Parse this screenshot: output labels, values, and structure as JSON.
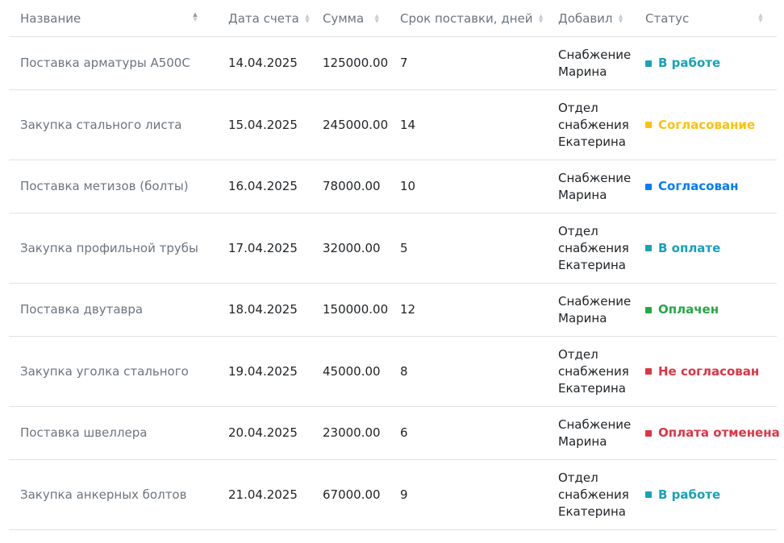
{
  "table": {
    "headers": {
      "name": "Название",
      "date": "Дата счета",
      "sum": "Сумма",
      "term": "Срок поставки, дней",
      "added_by": "Добавил",
      "status": "Статус"
    },
    "rows": [
      {
        "name": "Поставка арматуры А500С",
        "date": "14.04.2025",
        "sum": "125000.00",
        "term": "7",
        "added_by_line1": "Снабжение",
        "added_by_line2": "Марина",
        "added_by_line3": "",
        "status": "В работе",
        "status_color": "#17a2b8"
      },
      {
        "name": "Закупка стального листа",
        "date": "15.04.2025",
        "sum": "245000.00",
        "term": "14",
        "added_by_line1": "Отдел",
        "added_by_line2": "снабжения",
        "added_by_line3": "Екатерина",
        "status": "Согласование",
        "status_color": "#ffc107"
      },
      {
        "name": "Поставка метизов (болты)",
        "date": "16.04.2025",
        "sum": "78000.00",
        "term": "10",
        "added_by_line1": "Снабжение",
        "added_by_line2": "Марина",
        "added_by_line3": "",
        "status": "Согласован",
        "status_color": "#007bff"
      },
      {
        "name": "Закупка профильной трубы",
        "date": "17.04.2025",
        "sum": "32000.00",
        "term": "5",
        "added_by_line1": "Отдел",
        "added_by_line2": "снабжения",
        "added_by_line3": "Екатерина",
        "status": "В оплате",
        "status_color": "#17a2b8"
      },
      {
        "name": "Поставка двутавра",
        "date": "18.04.2025",
        "sum": "150000.00",
        "term": "12",
        "added_by_line1": "Снабжение",
        "added_by_line2": "Марина",
        "added_by_line3": "",
        "status": "Оплачен",
        "status_color": "#28a745"
      },
      {
        "name": "Закупка уголка стального",
        "date": "19.04.2025",
        "sum": "45000.00",
        "term": "8",
        "added_by_line1": "Отдел",
        "added_by_line2": "снабжения",
        "added_by_line3": "Екатерина",
        "status": "Не согласован",
        "status_color": "#dc3545"
      },
      {
        "name": "Поставка швеллера",
        "date": "20.04.2025",
        "sum": "23000.00",
        "term": "6",
        "added_by_line1": "Снабжение",
        "added_by_line2": "Марина",
        "added_by_line3": "",
        "status": "Оплата отменена",
        "status_color": "#dc3545"
      },
      {
        "name": "Закупка анкерных болтов",
        "date": "21.04.2025",
        "sum": "67000.00",
        "term": "9",
        "added_by_line1": "Отдел",
        "added_by_line2": "снабжения",
        "added_by_line3": "Екатерина",
        "status": "В работе",
        "status_color": "#17a2b8"
      }
    ]
  },
  "icons": {
    "sort": "sort-arrows-icon",
    "status": "status-square-icon"
  }
}
